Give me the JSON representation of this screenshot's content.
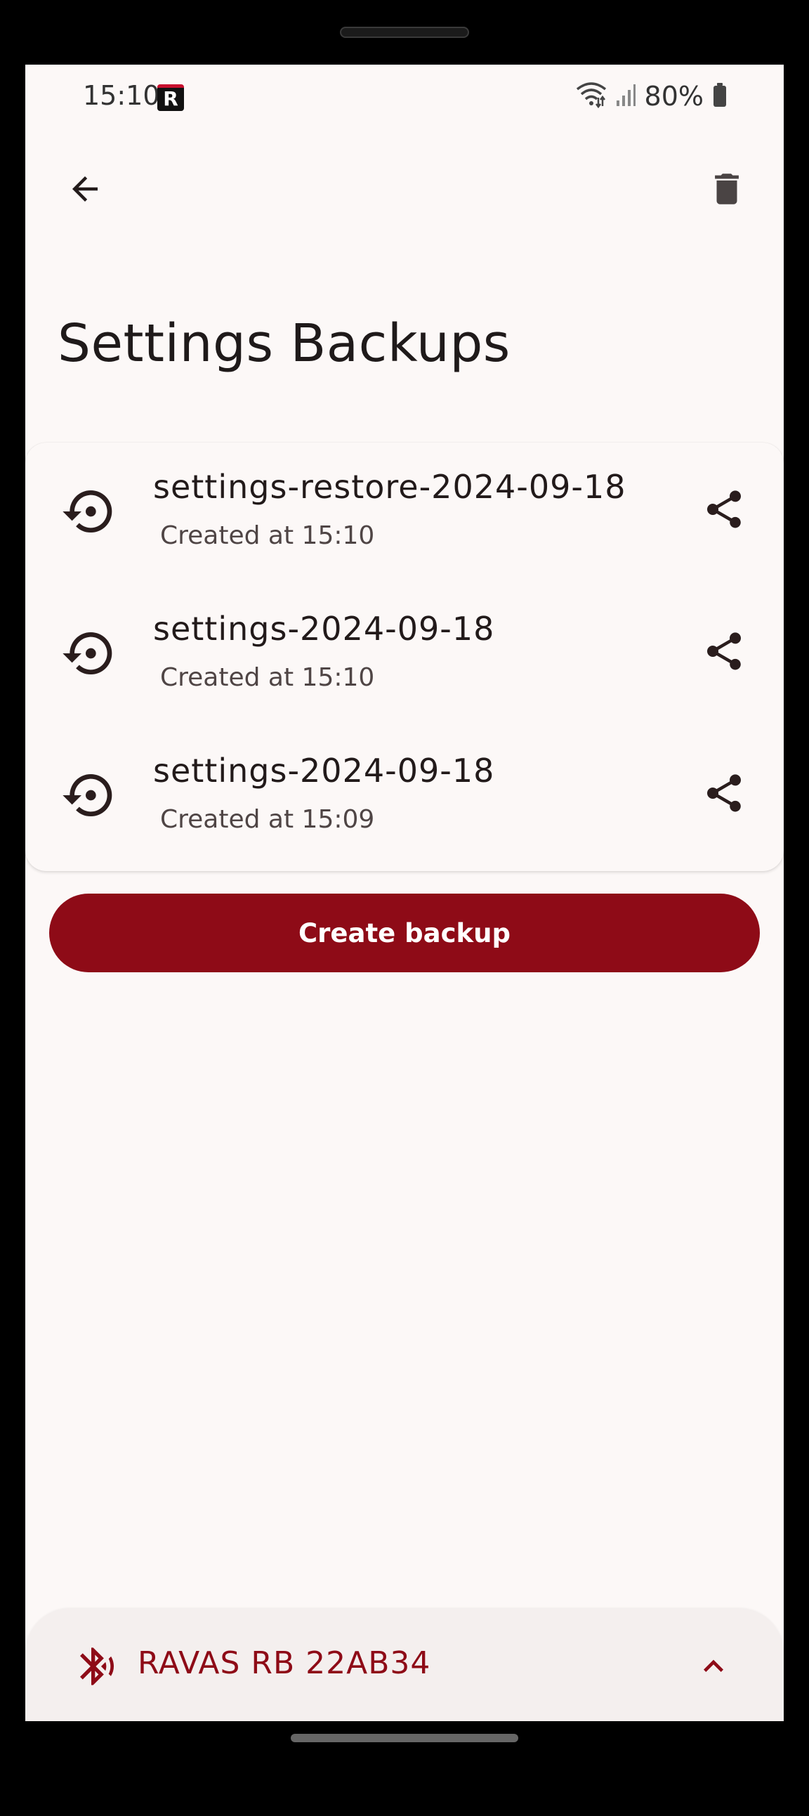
{
  "status_bar": {
    "time": "15:10",
    "app_icon_letter": "R",
    "battery": "80%"
  },
  "header": {
    "back_icon": "arrow-back-icon",
    "delete_icon": "trash-icon"
  },
  "page": {
    "title": "Settings Backups"
  },
  "backups": [
    {
      "name": "settings-restore-2024-09-18",
      "created": "Created at 15:10"
    },
    {
      "name": "settings-2024-09-18",
      "created": "Created at 15:10"
    },
    {
      "name": "settings-2024-09-18",
      "created": "Created at 15:09"
    }
  ],
  "actions": {
    "create_backup_label": "Create backup"
  },
  "device_sheet": {
    "device_name": "RAVAS RB 22AB34",
    "bt_icon": "bluetooth-icon",
    "expand_icon": "chevron-up-icon"
  },
  "colors": {
    "primary": "#8e0b17",
    "background": "#fcf8f7",
    "text": "#221a1a"
  }
}
